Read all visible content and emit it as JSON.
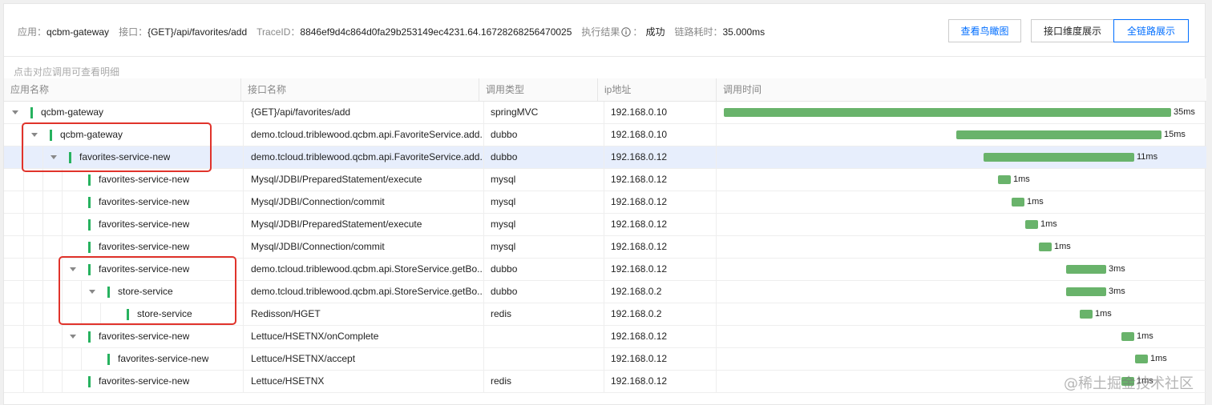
{
  "info": {
    "app_label": "应用：",
    "app_value": "qcbm-gateway",
    "iface_label": "接口：",
    "iface_value": "{GET}/api/favorites/add",
    "trace_label": "TraceID：",
    "trace_value": "8846ef9d4c864d0fa29b253149ec4231.64.16728268256470025",
    "result_label": "执行结果",
    "result_value": "成功",
    "duration_label": "链路耗时：",
    "duration_value": "35.000ms"
  },
  "buttons": {
    "birdview": "查看鸟瞰图",
    "interface_dim": "接口维度展示",
    "full_chain": "全链路展示"
  },
  "hint": "点击对应调用可查看明细",
  "columns": [
    "应用名称",
    "接口名称",
    "调用类型",
    "ip地址",
    "调用时间"
  ],
  "rows": [
    {
      "name": "qcbm-gateway",
      "iface": "{GET}/api/favorites/add",
      "type": "springMVC",
      "ip": "192.168.0.10",
      "time": "35ms"
    },
    {
      "name": "qcbm-gateway",
      "iface": "demo.tcloud.triblewood.qcbm.api.FavoriteService.add...",
      "type": "dubbo",
      "ip": "192.168.0.10",
      "time": "15ms"
    },
    {
      "name": "favorites-service-new",
      "iface": "demo.tcloud.triblewood.qcbm.api.FavoriteService.add...",
      "type": "dubbo",
      "ip": "192.168.0.12",
      "time": "11ms"
    },
    {
      "name": "favorites-service-new",
      "iface": "Mysql/JDBI/PreparedStatement/execute",
      "type": "mysql",
      "ip": "192.168.0.12",
      "time": "1ms"
    },
    {
      "name": "favorites-service-new",
      "iface": "Mysql/JDBI/Connection/commit",
      "type": "mysql",
      "ip": "192.168.0.12",
      "time": "1ms"
    },
    {
      "name": "favorites-service-new",
      "iface": "Mysql/JDBI/PreparedStatement/execute",
      "type": "mysql",
      "ip": "192.168.0.12",
      "time": "1ms"
    },
    {
      "name": "favorites-service-new",
      "iface": "Mysql/JDBI/Connection/commit",
      "type": "mysql",
      "ip": "192.168.0.12",
      "time": "1ms"
    },
    {
      "name": "favorites-service-new",
      "iface": "demo.tcloud.triblewood.qcbm.api.StoreService.getBo...",
      "type": "dubbo",
      "ip": "192.168.0.12",
      "time": "3ms"
    },
    {
      "name": "store-service",
      "iface": "demo.tcloud.triblewood.qcbm.api.StoreService.getBo...",
      "type": "dubbo",
      "ip": "192.168.0.2",
      "time": "3ms"
    },
    {
      "name": "store-service",
      "iface": "Redisson/HGET",
      "type": "redis",
      "ip": "192.168.0.2",
      "time": "1ms"
    },
    {
      "name": "favorites-service-new",
      "iface": "Lettuce/HSETNX/onComplete",
      "type": "",
      "ip": "192.168.0.12",
      "time": "1ms"
    },
    {
      "name": "favorites-service-new",
      "iface": "Lettuce/HSETNX/accept",
      "type": "",
      "ip": "192.168.0.12",
      "time": "1ms"
    },
    {
      "name": "favorites-service-new",
      "iface": "Lettuce/HSETNX",
      "type": "redis",
      "ip": "192.168.0.12",
      "time": "1ms"
    }
  ],
  "watermark": "@稀土掘金技术社区",
  "colors": {
    "accent": "#006eff",
    "bar": "#69b36b",
    "status_green": "#27b25f",
    "highlight": "#e0332b"
  }
}
